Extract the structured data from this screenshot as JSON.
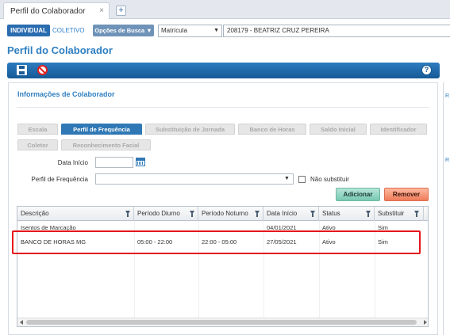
{
  "window_tab": {
    "title": "Perfil do Colaborador",
    "close": "×",
    "new_tab": "+"
  },
  "search": {
    "btn_individual": "INDIVIDUAL",
    "btn_coletivo": "COLETIVO",
    "btn_opcoes": "Opções de Busca ▼",
    "filter_type": "Matrícula",
    "colaborador": "208179 - BEATRIZ CRUZ PEREIRA"
  },
  "page_title": "Perfil do Colaborador",
  "toolbar": {
    "help": "?"
  },
  "right_panel": {
    "r1": "R",
    "r2": "R"
  },
  "panel": {
    "title": "Informações de Colaborador",
    "tabs": [
      "Escala",
      "Perfil de Frequência",
      "Substituição de Jornada",
      "Banco de Horas",
      "Saldo Inicial",
      "Identificador",
      "Coletor",
      "Reconhecimento Facial"
    ],
    "active_tab": "Perfil de Frequência",
    "form": {
      "data_inicio_label": "Data Início",
      "data_inicio_value": "",
      "perfil_label": "Perfil de Frequência",
      "perfil_value": "",
      "nao_substituir_label": "Não substituir"
    },
    "buttons": {
      "add": "Adicionar",
      "remove": "Remover"
    },
    "grid": {
      "columns": [
        "Descrição",
        "Período Diurno",
        "Período Noturno",
        "Data Início",
        "Status",
        "Substituir"
      ],
      "rows": [
        [
          "Isentos de Marcação",
          "",
          "",
          "04/01/2021",
          "Ativo",
          "Sim"
        ],
        [
          "BANCO DE HORAS MG",
          "05:00 - 22:00",
          "22:00 - 05:00",
          "27/05/2021",
          "Ativo",
          "Sim"
        ]
      ]
    }
  },
  "colors": {
    "accent": "#2f7fc1",
    "toolbar": "#1b5a94",
    "highlight": "#e4161b"
  }
}
